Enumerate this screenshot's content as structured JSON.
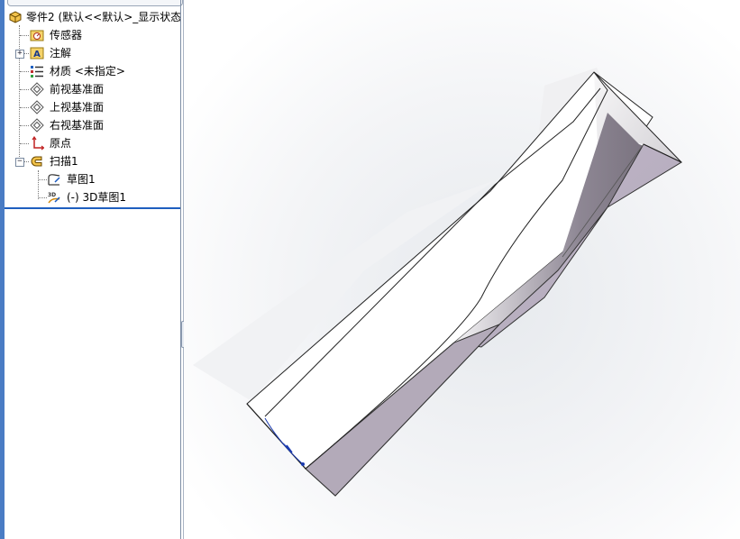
{
  "feature_tree": {
    "root": {
      "label": "零件2 (默认<<默认>_显示状态",
      "icon": "part-icon"
    },
    "items": [
      {
        "label": "传感器",
        "icon": "sensor-folder-icon"
      },
      {
        "label": "注解",
        "icon": "annotation-folder-icon",
        "toggle": "+"
      },
      {
        "label": "材质 <未指定>",
        "icon": "material-icon"
      },
      {
        "label": "前视基准面",
        "icon": "plane-icon"
      },
      {
        "label": "上视基准面",
        "icon": "plane-icon"
      },
      {
        "label": "右视基准面",
        "icon": "plane-icon"
      },
      {
        "label": "原点",
        "icon": "origin-icon"
      },
      {
        "label": "扫描1",
        "icon": "sweep-feature-icon",
        "toggle": "−"
      }
    ],
    "children": [
      {
        "label": "草图1",
        "icon": "sketch-icon"
      },
      {
        "label": "(-) 3D草图1",
        "icon": "3d-sketch-icon"
      }
    ]
  },
  "colors": {
    "accent": "#1f5fbf",
    "model_side": "#b9afc0",
    "model_shade": "#8a8290"
  }
}
